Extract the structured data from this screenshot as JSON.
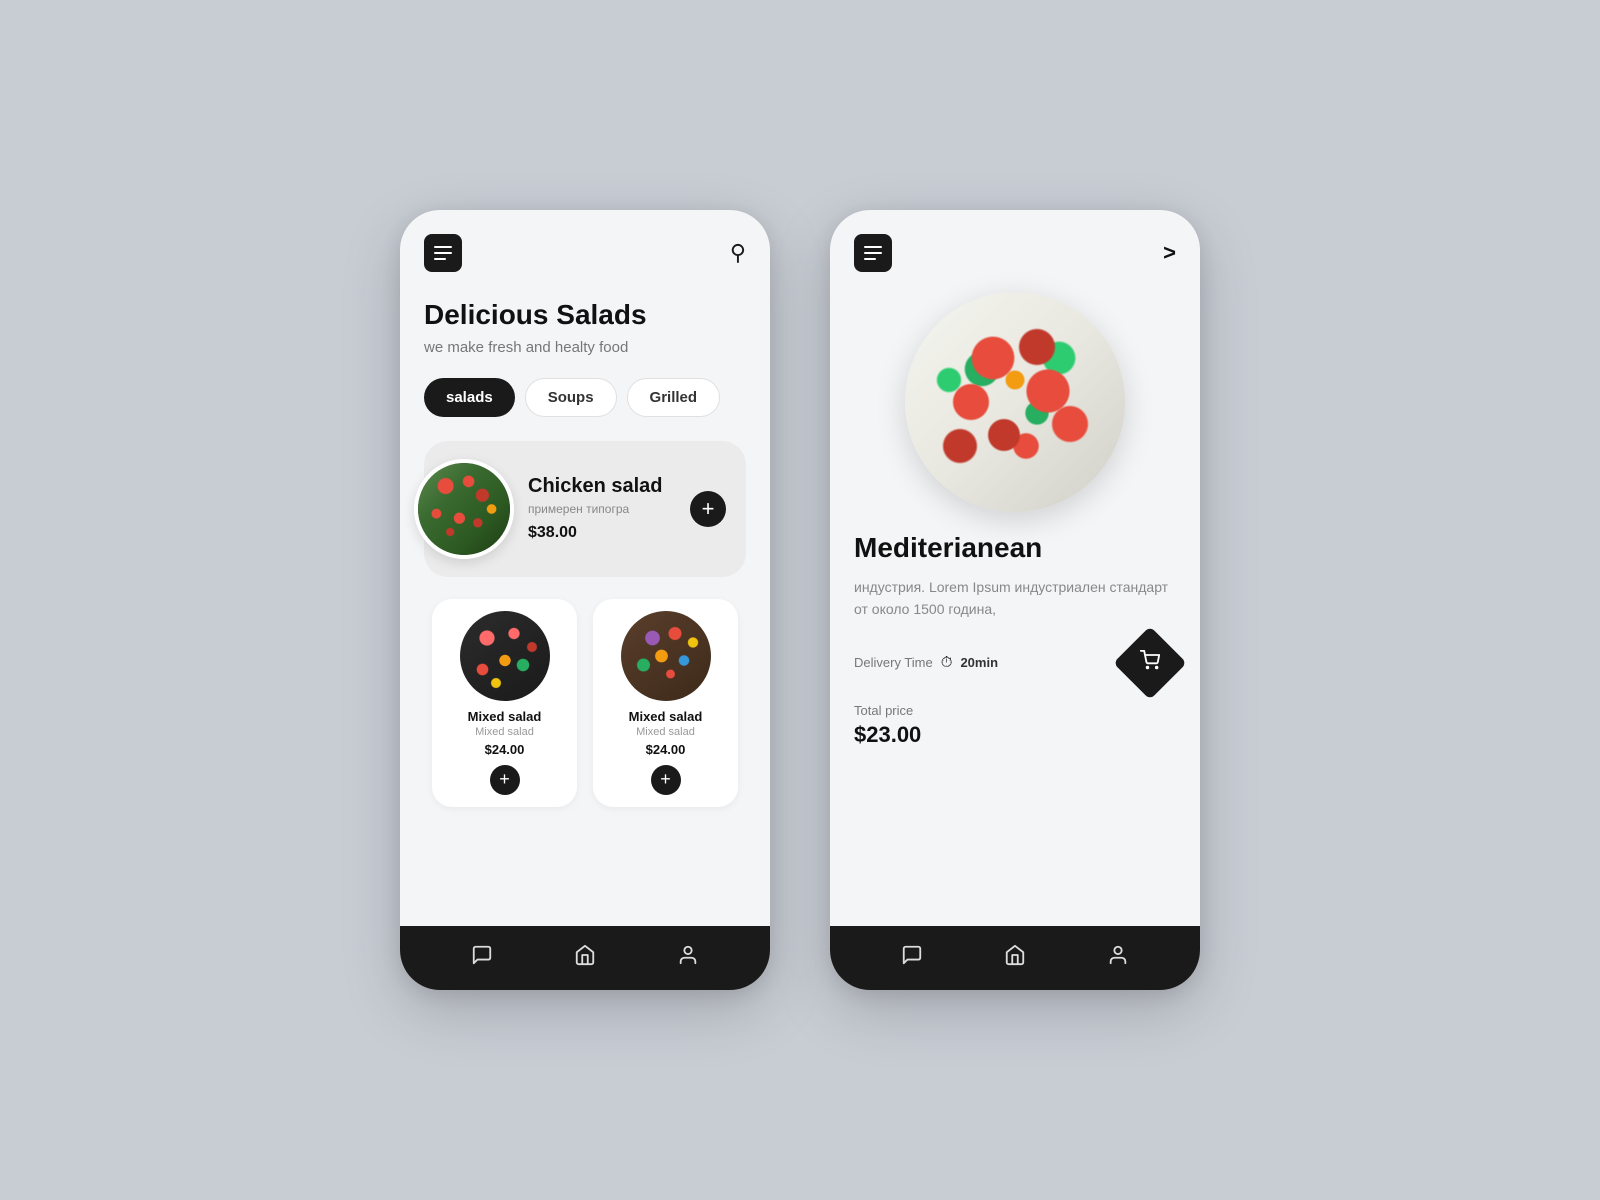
{
  "app": {
    "background": "#c8cdd4"
  },
  "screen1": {
    "title": "Delicious Salads",
    "subtitle": "we make fresh and healty food",
    "categories": [
      {
        "label": "salads",
        "active": true
      },
      {
        "label": "Soups",
        "active": false
      },
      {
        "label": "Grilled",
        "active": false
      }
    ],
    "featured": {
      "name": "Chicken salad",
      "description": "примерен типогра",
      "price": "$38.00",
      "add_label": "+"
    },
    "small_cards": [
      {
        "name": "Mixed salad",
        "sub": "Mixed salad",
        "price": "$24.00",
        "add_label": "+"
      },
      {
        "name": "Mixed salad",
        "sub": "Mixed salad",
        "price": "$24.00",
        "add_label": "+"
      }
    ],
    "nav": {
      "chat_icon": "💬",
      "home_icon": "⌂",
      "user_icon": "👤"
    }
  },
  "screen2": {
    "item_title": "Mediterianean",
    "description": "индустрия. Lorem Ipsum индустриален стандарт от около 1500 година,",
    "delivery_label": "Delivery Time",
    "delivery_time": "20min",
    "total_label": "Total price",
    "total_price": "$23.00",
    "nav": {
      "chat_icon": "💬",
      "home_icon": "⌂",
      "user_icon": "👤"
    }
  }
}
